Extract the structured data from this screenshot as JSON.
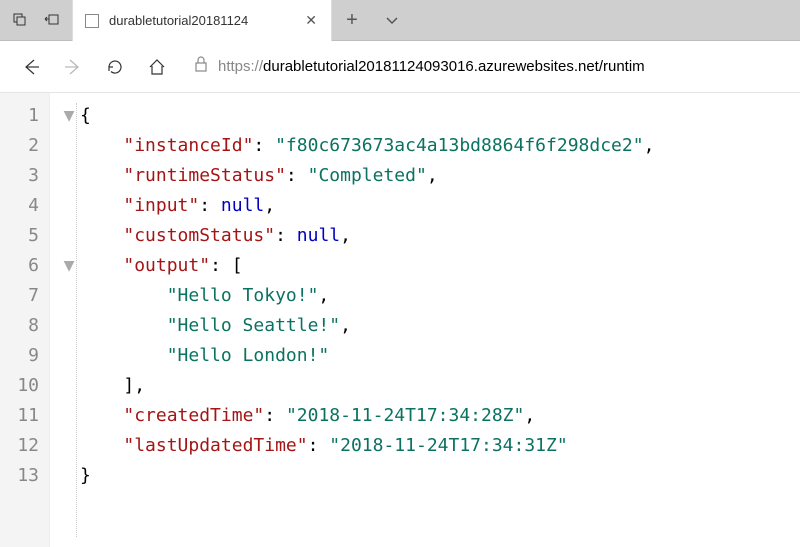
{
  "tabbar": {
    "title": "durabletutorial20181124"
  },
  "addressbar": {
    "scheme": "https://",
    "rest": "durabletutorial20181124093016.azurewebsites.net/runtim"
  },
  "json": {
    "lines": [
      "1",
      "2",
      "3",
      "4",
      "5",
      "6",
      "7",
      "8",
      "9",
      "10",
      "11",
      "12",
      "13"
    ],
    "keys": {
      "instanceId": "\"instanceId\"",
      "runtimeStatus": "\"runtimeStatus\"",
      "input": "\"input\"",
      "customStatus": "\"customStatus\"",
      "output": "\"output\"",
      "createdTime": "\"createdTime\"",
      "lastUpdatedTime": "\"lastUpdatedTime\""
    },
    "vals": {
      "instanceId": "\"f80c673673ac4a13bd8864f6f298dce2\"",
      "runtimeStatus": "\"Completed\"",
      "null": "null",
      "out0": "\"Hello Tokyo!\"",
      "out1": "\"Hello Seattle!\"",
      "out2": "\"Hello London!\"",
      "createdTime": "\"2018-11-24T17:34:28Z\"",
      "lastUpdatedTime": "\"2018-11-24T17:34:31Z\""
    },
    "punct": {
      "lbrace": "{",
      "rbrace": "}",
      "lbracket": "[",
      "rbracket": "],",
      "colon": ": ",
      "comma": ","
    }
  },
  "chart_data": {
    "type": "table",
    "title": "Durable Function instance status JSON",
    "data": {
      "instanceId": "f80c673673ac4a13bd8864f6f298dce2",
      "runtimeStatus": "Completed",
      "input": null,
      "customStatus": null,
      "output": [
        "Hello Tokyo!",
        "Hello Seattle!",
        "Hello London!"
      ],
      "createdTime": "2018-11-24T17:34:28Z",
      "lastUpdatedTime": "2018-11-24T17:34:31Z"
    }
  }
}
